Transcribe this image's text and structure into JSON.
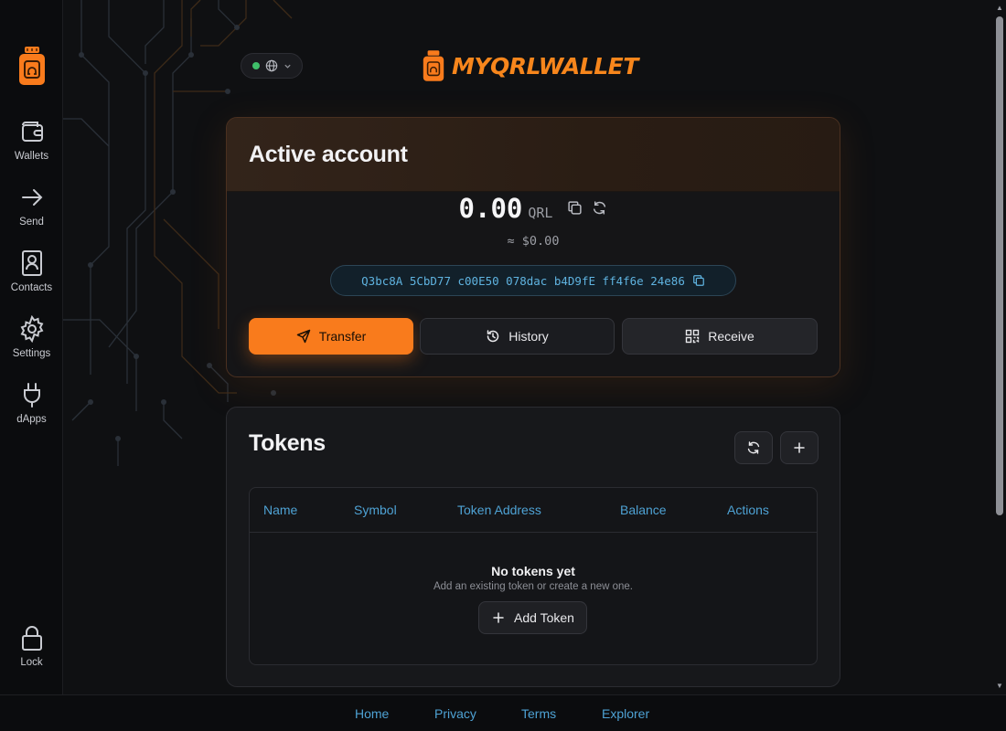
{
  "colors": {
    "accent": "#f97b1c",
    "link": "#4ea2d4",
    "address": "#5fb3e0",
    "online": "#3fbf6a"
  },
  "sidebar": {
    "logo_icon": "wallet-logo-icon",
    "items": [
      {
        "label": "Wallets",
        "icon": "wallet-icon"
      },
      {
        "label": "Send",
        "icon": "arrow-right-icon"
      },
      {
        "label": "Contacts",
        "icon": "contact-book-icon"
      },
      {
        "label": "Settings",
        "icon": "gear-icon"
      },
      {
        "label": "dApps",
        "icon": "plug-icon"
      }
    ],
    "lock": {
      "label": "Lock",
      "icon": "lock-icon"
    }
  },
  "header": {
    "brand": "MYQRLWALLET",
    "network_status": "online"
  },
  "account": {
    "title": "Active account",
    "balance": "0.00",
    "unit": "QRL",
    "fiat": "≈ $0.00",
    "address": "Q3bc8A 5CbD77 c00E50 078dac b4D9fE ff4f6e 24e86",
    "actions": {
      "transfer": "Transfer",
      "history": "History",
      "receive": "Receive"
    }
  },
  "tokens": {
    "title": "Tokens",
    "columns": [
      "Name",
      "Symbol",
      "Token Address",
      "Balance",
      "Actions"
    ],
    "empty_title": "No tokens yet",
    "empty_subtitle": "Add an existing token or create a new one.",
    "add_label": "Add Token"
  },
  "footer": {
    "links": [
      "Home",
      "Privacy",
      "Terms",
      "Explorer"
    ]
  }
}
